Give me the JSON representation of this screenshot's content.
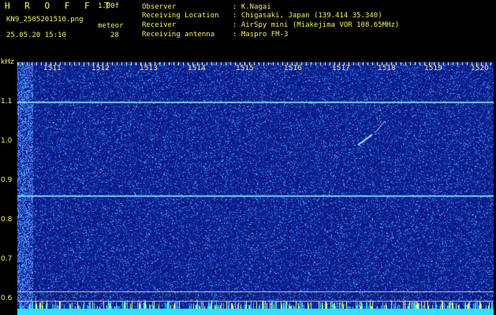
{
  "header": {
    "app_title": "H R O F F T",
    "version": "1.00f",
    "filename": "KN9_2505201510.png",
    "datetime": "25.05.20 15:10",
    "meteor_label": "meteor",
    "meteor_count": "28"
  },
  "info": [
    {
      "label": "Observer",
      "value": ": K.Nagai"
    },
    {
      "label": "Receiving Location",
      "value": ": Chigasaki, Japan (139.414 35.340)"
    },
    {
      "label": "Receiver",
      "value": ": AirSpy mini (Miakejima VOR 108.65MHz)"
    },
    {
      "label": "Receiving antenna",
      "value": ": Maspro FM-3"
    }
  ],
  "axis": {
    "unit": "kHz",
    "time_ticks": [
      "1511",
      "1512",
      "1513",
      "1514",
      "1515",
      "1516",
      "1517",
      "1518",
      "1519",
      "1520"
    ],
    "freq_ticks": [
      "1.1",
      "1.0",
      "0.9",
      "0.8",
      "0.7",
      "0.6"
    ]
  },
  "colors": {
    "text": "#f2f25a",
    "background": "#0a0f7a",
    "noise": "#3a6cff",
    "carrier": "#7fe8ff",
    "bottom_band": "#30e0ff"
  }
}
